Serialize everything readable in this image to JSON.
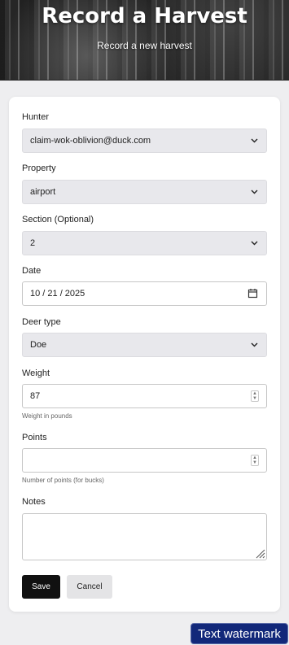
{
  "header": {
    "title": "Record a Harvest",
    "subtitle": "Record a new harvest"
  },
  "form": {
    "hunter": {
      "label": "Hunter",
      "value": "claim-wok-oblivion@duck.com"
    },
    "property": {
      "label": "Property",
      "value": "airport"
    },
    "section": {
      "label": "Section (Optional)",
      "value": "2"
    },
    "date": {
      "label": "Date",
      "value": "10 / 21 / 2025"
    },
    "deer_type": {
      "label": "Deer type",
      "value": "Doe"
    },
    "weight": {
      "label": "Weight",
      "value": "87",
      "hint": "Weight in pounds"
    },
    "points": {
      "label": "Points",
      "value": "",
      "hint": "Number of points (for bucks)"
    },
    "notes": {
      "label": "Notes",
      "value": ""
    },
    "save_label": "Save",
    "cancel_label": "Cancel"
  },
  "watermark": "Text watermark",
  "icons": {
    "select_arrow": "chevron-down-icon",
    "date": "calendar-icon",
    "number": "spinner-icon",
    "resize": "resize-grip-icon"
  }
}
